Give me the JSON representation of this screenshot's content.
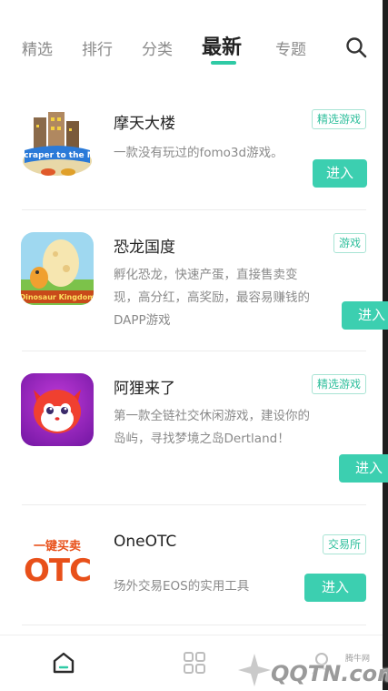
{
  "tabs": [
    {
      "label": "精选"
    },
    {
      "label": "排行"
    },
    {
      "label": "分类"
    },
    {
      "label": "最新"
    },
    {
      "label": "专题"
    }
  ],
  "apps": [
    {
      "title": "摩天大楼",
      "tag": "精选游戏",
      "desc": "一款没有玩过的fomo3d游戏。",
      "button": "进入",
      "icon_text": "Skyscraper to the Moon"
    },
    {
      "title": "恐龙国度",
      "tag": "游戏",
      "desc": "孵化恐龙，快速产蛋，直接售卖变现，高分红，高奖励，最容易赚钱的DAPP游戏",
      "button": "进入",
      "icon_text": "Dinosaur Kingdom"
    },
    {
      "title": "阿狸来了",
      "tag": "精选游戏",
      "desc": "第一款全链社交休闲游戏，建设你的岛屿，寻找梦境之岛Dertland！",
      "button": "进入"
    },
    {
      "title": "OneOTC",
      "tag": "交易所",
      "desc": "场外交易EOS的实用工具",
      "button": "进入",
      "icon_line1": "一键买卖",
      "icon_line2": "OTC"
    }
  ],
  "bottom_nav": [
    {
      "icon": "home-icon"
    },
    {
      "icon": "grid-icon"
    },
    {
      "icon": "profile-icon"
    }
  ],
  "watermark": {
    "text": "QQTN.com",
    "small": "腾牛网"
  },
  "colors": {
    "accent": "#3ccfb0",
    "tag_text": "#2fbf9c"
  }
}
